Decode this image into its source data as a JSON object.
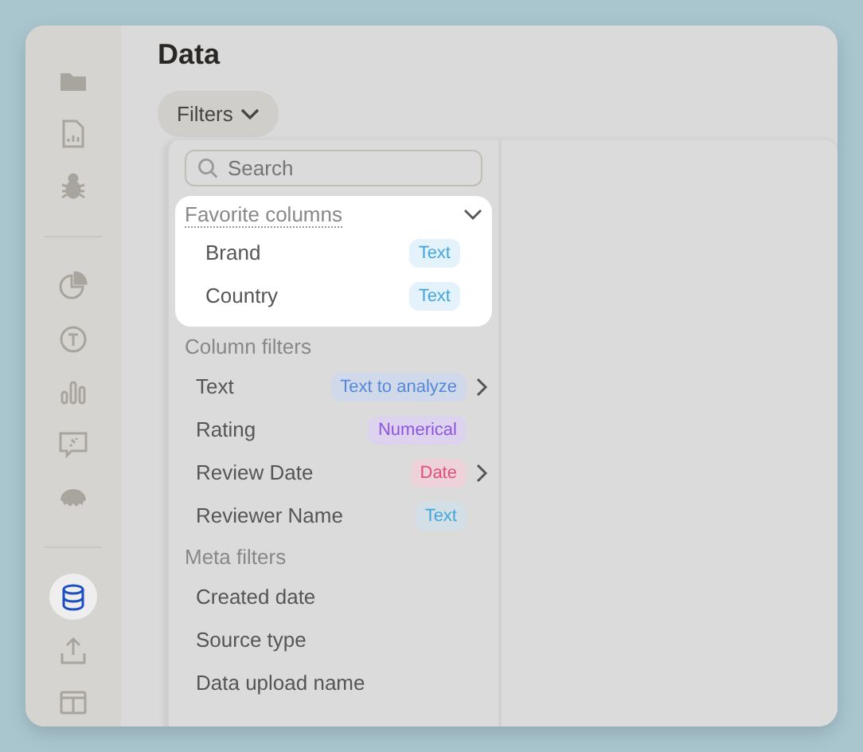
{
  "sidebar": {
    "groups": [
      [
        {
          "selected": false
        },
        {
          "selected": false
        },
        {
          "selected": false
        }
      ],
      [
        {
          "selected": false
        },
        {
          "selected": false
        },
        {
          "selected": false
        },
        {
          "selected": false
        },
        {
          "selected": false
        }
      ],
      [
        {
          "selected": true
        },
        {
          "selected": false
        },
        {
          "selected": false
        }
      ]
    ]
  },
  "page": {
    "title": "Data"
  },
  "filters_button": {
    "label": "Filters"
  },
  "filter_menu": {
    "search": {
      "placeholder": "Search"
    },
    "favorites": {
      "title": "Favorite columns",
      "expanded": true,
      "items": [
        {
          "label": "Brand",
          "tag": {
            "label": "Text",
            "kind": "text"
          },
          "has_submenu": false
        },
        {
          "label": "Country",
          "tag": {
            "label": "Text",
            "kind": "text"
          },
          "has_submenu": false
        }
      ]
    },
    "sections": [
      {
        "title": "Column filters",
        "items": [
          {
            "label": "Text",
            "tag": {
              "label": "Text to analyze",
              "kind": "analyze"
            },
            "has_submenu": true
          },
          {
            "label": "Rating",
            "tag": {
              "label": "Numerical",
              "kind": "numerical"
            },
            "has_submenu": false
          },
          {
            "label": "Review Date",
            "tag": {
              "label": "Date",
              "kind": "date"
            },
            "has_submenu": true
          },
          {
            "label": "Reviewer Name",
            "tag": {
              "label": "Text",
              "kind": "text"
            },
            "has_submenu": false
          }
        ]
      },
      {
        "title": "Meta filters",
        "items": [
          {
            "label": "Created date",
            "has_submenu": false
          },
          {
            "label": "Source type",
            "has_submenu": false
          },
          {
            "label": "Data upload name",
            "has_submenu": false
          }
        ]
      }
    ]
  }
}
